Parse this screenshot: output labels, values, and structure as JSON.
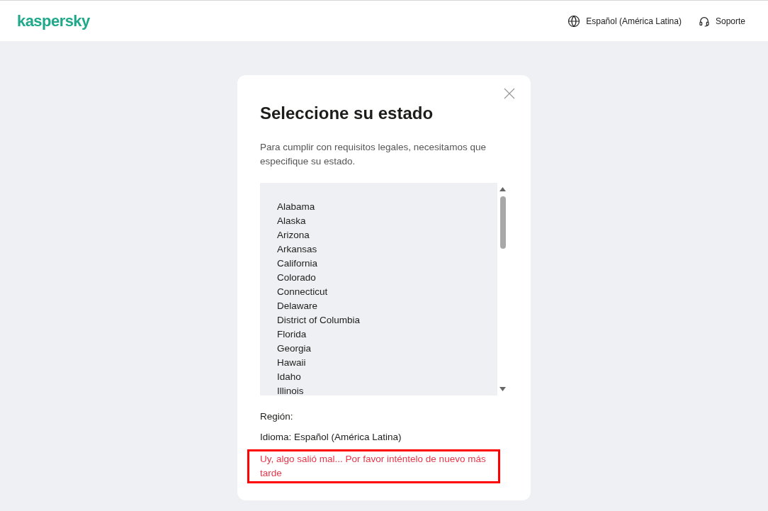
{
  "header": {
    "logo": "kaspersky",
    "language": "Español (América Latina)",
    "support": "Soporte"
  },
  "dialog": {
    "title": "Seleccione su estado",
    "description": "Para cumplir con requisitos legales, necesitamos que especifique su estado.",
    "states": [
      "Alabama",
      "Alaska",
      "Arizona",
      "Arkansas",
      "California",
      "Colorado",
      "Connecticut",
      "Delaware",
      "District of Columbia",
      "Florida",
      "Georgia",
      "Hawaii",
      "Idaho",
      "Illinois"
    ],
    "region_label": "Región:",
    "language_line": "Idioma: Español (América Latina)",
    "error": "Uy, algo salió mal... Por favor inténtelo de nuevo más tarde"
  }
}
